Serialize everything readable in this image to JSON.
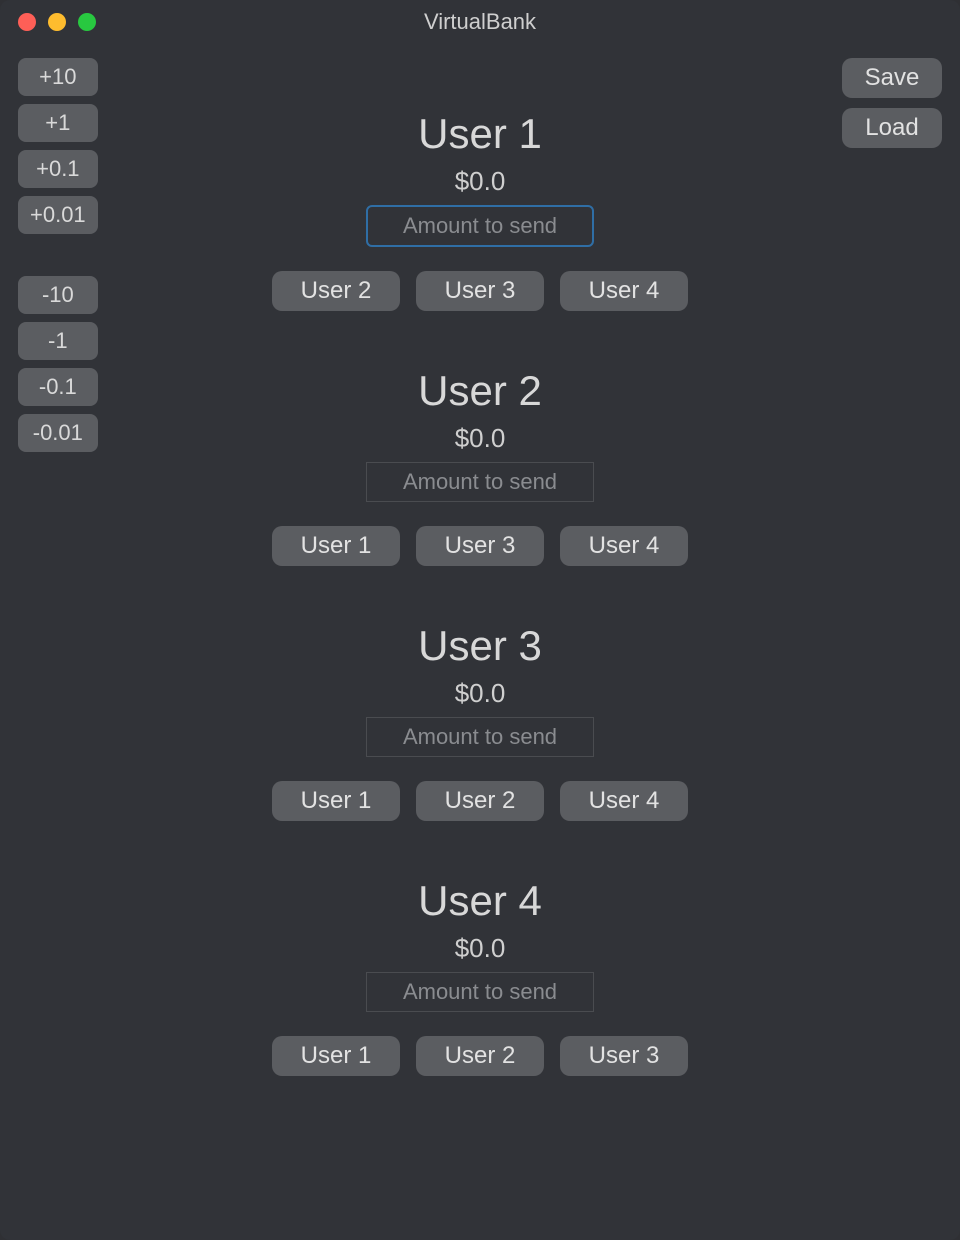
{
  "window_title": "VirtualBank",
  "adjustments_inc": [
    "+10",
    "+1",
    "+0.1",
    "+0.01"
  ],
  "adjustments_dec": [
    "-10",
    "-1",
    "-0.1",
    "-0.01"
  ],
  "save_label": "Save",
  "load_label": "Load",
  "amount_placeholder": "Amount to send",
  "users": [
    {
      "name": "User 1",
      "balance": "$0.0",
      "focused": true,
      "targets": [
        "User 2",
        "User 3",
        "User 4"
      ]
    },
    {
      "name": "User 2",
      "balance": "$0.0",
      "focused": false,
      "targets": [
        "User 1",
        "User 3",
        "User 4"
      ]
    },
    {
      "name": "User 3",
      "balance": "$0.0",
      "focused": false,
      "targets": [
        "User 1",
        "User 2",
        "User 4"
      ]
    },
    {
      "name": "User 4",
      "balance": "$0.0",
      "focused": false,
      "targets": [
        "User 1",
        "User 2",
        "User 3"
      ]
    }
  ]
}
